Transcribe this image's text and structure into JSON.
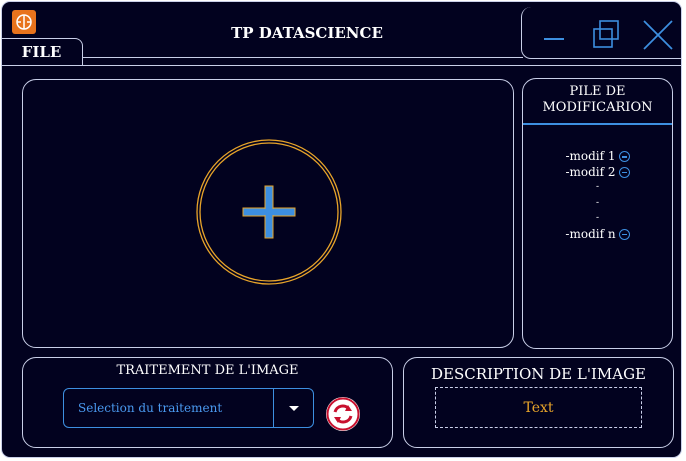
{
  "app": {
    "title": "TP DATASCIENCE",
    "icon": "app-logo-icon"
  },
  "menu": {
    "file_label": "FILE"
  },
  "window_controls": [
    "minimize-icon",
    "restore-icon",
    "close-icon"
  ],
  "canvas": {
    "add_icon": "add-image-icon"
  },
  "pile": {
    "title_line1": "PILE DE",
    "title_line2": "MODIFICARION",
    "items": [
      {
        "label": "-modif 1"
      },
      {
        "label": "-modif 2"
      },
      {
        "label": "-modif n"
      }
    ],
    "ellipsis": [
      "-",
      "-",
      "-"
    ]
  },
  "traitement": {
    "title": "TRAITEMENT DE L'IMAGE",
    "select_value": "Selection du traitement",
    "refresh_icon": "refresh-icon"
  },
  "description": {
    "title": "DESCRIPTION DE L'IMAGE",
    "text": "Text"
  },
  "colors": {
    "background": "#02021f",
    "border": "#c9cfe8",
    "accent_blue": "#3d8fe0",
    "accent_orange": "#e8a42a",
    "refresh_red": "#c8102e"
  }
}
